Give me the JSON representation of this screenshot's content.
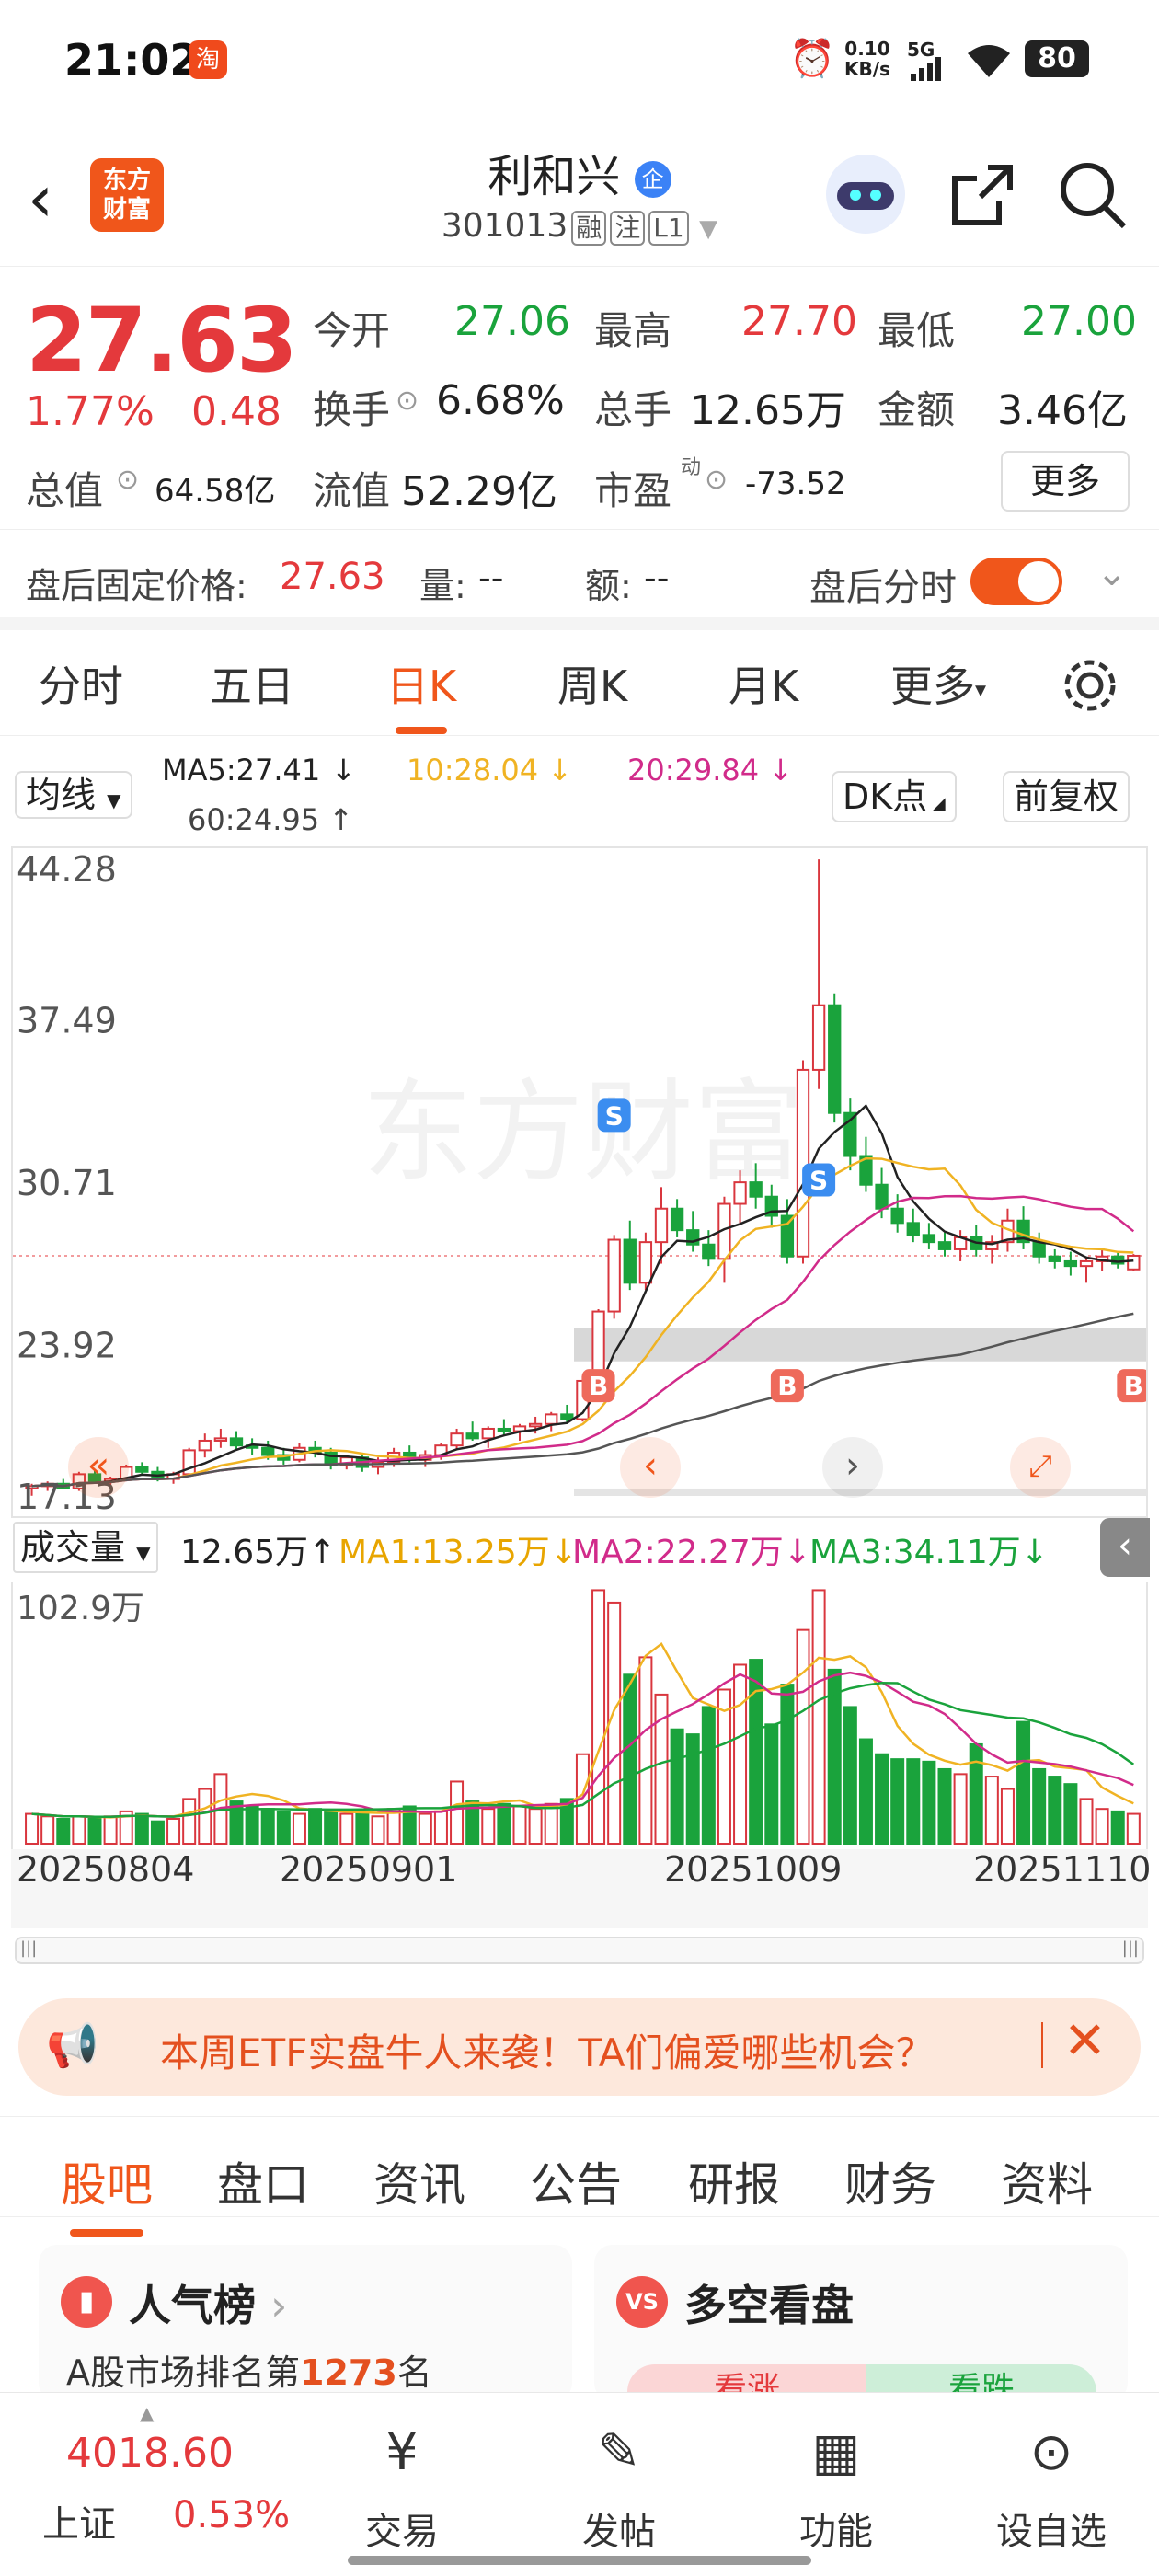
{
  "status": {
    "time": "21:02",
    "speed": "0.10\nKB/s",
    "speed_top": "0.10",
    "speed_bot": "KB/s",
    "network": "5G",
    "battery": "80"
  },
  "nav": {
    "logo_line1": "东方",
    "logo_line2": "财富",
    "name": "利和兴",
    "name_badge": "企",
    "code": "301013",
    "tags": [
      "融",
      "注",
      "L1"
    ]
  },
  "quote": {
    "price": "27.63",
    "change_pct": "1.77%",
    "change": "0.48",
    "open_label": "今开",
    "open": "27.06",
    "high_label": "最高",
    "high": "27.70",
    "low_label": "最低",
    "low": "27.00",
    "turnover_label": "换手",
    "turnover": "6.68%",
    "vol_label": "总手",
    "vol": "12.65万",
    "amount_label": "金额",
    "amount": "3.46亿",
    "mktcap_label": "总值",
    "mktcap": "64.58亿",
    "float_label": "流值",
    "float": "52.29亿",
    "pe_label": "市盈",
    "pe_sup": "动",
    "pe": "-73.52",
    "more_label": "更多"
  },
  "after_hours": {
    "price_label": "盘后固定价格:",
    "price": "27.63",
    "vol_label": "量:",
    "vol": "--",
    "amt_label": "额:",
    "amt": "--",
    "toggle_label": "盘后分时"
  },
  "tabs": [
    "分时",
    "五日",
    "日K",
    "周K",
    "月K",
    "更多"
  ],
  "active_tab": "日K",
  "indicators": {
    "ma_box": "均线",
    "ma5": "MA5:27.41",
    "ma10": "10:28.04",
    "ma20": "20:29.84",
    "ma60": "60:24.95",
    "dk_box": "DK点",
    "adj_box": "前复权"
  },
  "chart_data": {
    "type": "candlestick",
    "price_ticks": [
      "44.28",
      "37.49",
      "30.71",
      "23.92",
      "17.13"
    ],
    "ylim": [
      17.13,
      44.28
    ],
    "markers": [
      "S",
      "B",
      "S",
      "B",
      "B"
    ],
    "x_dates": [
      "20250804",
      "20250901",
      "20251009",
      "20251110"
    ],
    "colors": {
      "up": "#d9363e",
      "down": "#1aa33c",
      "ma5": "#222222",
      "ma10": "#f0b323",
      "ma20": "#d12b8a",
      "ma60": "#555555"
    },
    "candles": [
      [
        17.9,
        18.1,
        17.6,
        18.0
      ],
      [
        18.0,
        18.2,
        17.8,
        18.1
      ],
      [
        18.1,
        18.3,
        17.9,
        17.9
      ],
      [
        17.9,
        18.6,
        17.8,
        18.5
      ],
      [
        18.5,
        18.7,
        18.1,
        18.2
      ],
      [
        18.2,
        18.4,
        18.0,
        18.3
      ],
      [
        18.3,
        18.9,
        18.2,
        18.8
      ],
      [
        18.8,
        19.0,
        18.5,
        18.6
      ],
      [
        18.6,
        18.8,
        18.2,
        18.3
      ],
      [
        18.3,
        18.6,
        18.1,
        18.5
      ],
      [
        18.5,
        19.6,
        18.4,
        19.5
      ],
      [
        19.5,
        20.2,
        19.2,
        19.9
      ],
      [
        19.9,
        20.4,
        19.6,
        20.0
      ],
      [
        20.0,
        20.3,
        19.5,
        19.7
      ],
      [
        19.7,
        20.0,
        19.3,
        19.6
      ],
      [
        19.6,
        19.9,
        19.1,
        19.3
      ],
      [
        19.3,
        19.6,
        18.9,
        19.1
      ],
      [
        19.1,
        19.8,
        19.0,
        19.6
      ],
      [
        19.6,
        19.9,
        19.2,
        19.4
      ],
      [
        19.4,
        19.6,
        18.7,
        18.9
      ],
      [
        18.9,
        19.3,
        18.7,
        19.2
      ],
      [
        19.2,
        19.4,
        18.6,
        18.8
      ],
      [
        18.8,
        19.2,
        18.5,
        19.0
      ],
      [
        19.0,
        19.6,
        18.8,
        19.4
      ],
      [
        19.4,
        19.7,
        19.0,
        19.1
      ],
      [
        19.1,
        19.5,
        18.8,
        19.3
      ],
      [
        19.3,
        19.8,
        19.1,
        19.7
      ],
      [
        19.7,
        20.4,
        19.5,
        20.2
      ],
      [
        20.2,
        20.7,
        19.9,
        20.0
      ],
      [
        20.0,
        20.5,
        19.6,
        20.4
      ],
      [
        20.4,
        20.8,
        20.1,
        20.3
      ],
      [
        20.3,
        20.6,
        19.9,
        20.5
      ],
      [
        20.5,
        20.9,
        20.2,
        20.6
      ],
      [
        20.6,
        21.1,
        20.3,
        21.0
      ],
      [
        21.0,
        21.4,
        20.6,
        20.8
      ],
      [
        20.8,
        22.6,
        20.7,
        22.4
      ],
      [
        22.4,
        25.4,
        22.2,
        25.3
      ],
      [
        25.3,
        28.5,
        25.0,
        28.3
      ],
      [
        28.3,
        29.1,
        26.2,
        26.5
      ],
      [
        26.5,
        28.6,
        26.2,
        28.2
      ],
      [
        28.2,
        30.5,
        27.3,
        29.6
      ],
      [
        29.6,
        30.0,
        28.4,
        28.7
      ],
      [
        28.7,
        29.5,
        27.8,
        28.1
      ],
      [
        28.1,
        28.7,
        27.2,
        27.5
      ],
      [
        27.5,
        30.1,
        26.5,
        29.8
      ],
      [
        29.8,
        31.2,
        29.0,
        30.7
      ],
      [
        30.7,
        31.5,
        29.6,
        30.1
      ],
      [
        30.1,
        30.6,
        28.8,
        29.3
      ],
      [
        29.3,
        30.0,
        27.3,
        27.6
      ],
      [
        27.6,
        35.8,
        27.3,
        35.4
      ],
      [
        35.4,
        44.2,
        34.6,
        38.1
      ],
      [
        38.1,
        38.6,
        33.2,
        33.6
      ],
      [
        33.6,
        34.2,
        31.2,
        31.8
      ],
      [
        31.8,
        32.6,
        30.3,
        30.6
      ],
      [
        30.6,
        31.3,
        29.2,
        29.6
      ],
      [
        29.6,
        30.2,
        28.6,
        29.0
      ],
      [
        29.0,
        29.6,
        28.2,
        28.5
      ],
      [
        28.5,
        29.0,
        27.9,
        28.2
      ],
      [
        28.2,
        28.6,
        27.6,
        27.9
      ],
      [
        27.9,
        28.7,
        27.4,
        28.4
      ],
      [
        28.4,
        28.9,
        27.6,
        27.9
      ],
      [
        27.9,
        28.5,
        27.3,
        28.2
      ],
      [
        28.2,
        29.6,
        27.8,
        29.1
      ],
      [
        29.1,
        29.7,
        27.9,
        28.2
      ],
      [
        28.2,
        28.6,
        27.3,
        27.6
      ],
      [
        27.6,
        27.9,
        27.1,
        27.4
      ],
      [
        27.4,
        27.8,
        26.8,
        27.2
      ],
      [
        27.2,
        27.6,
        26.5,
        27.4
      ],
      [
        27.4,
        27.9,
        27.0,
        27.6
      ],
      [
        27.6,
        27.8,
        27.1,
        27.3
      ],
      [
        27.06,
        27.7,
        27.0,
        27.63
      ]
    ],
    "volume": {
      "label": "成交量",
      "value": "12.65万",
      "ma1": "MA1:13.25万",
      "ma2": "MA2:22.27万",
      "ma3": "MA3:34.11万",
      "max_tick": "102.9万",
      "ymax": 102.9,
      "values": [
        12,
        11,
        10,
        11,
        10,
        11,
        13,
        12,
        9,
        10,
        18,
        22,
        28,
        17,
        15,
        14,
        13,
        12,
        14,
        13,
        12,
        12,
        11,
        14,
        15,
        12,
        13,
        25,
        17,
        14,
        16,
        15,
        14,
        16,
        18,
        36,
        102,
        97,
        68,
        75,
        60,
        46,
        44,
        55,
        62,
        72,
        74,
        48,
        64,
        86,
        102,
        70,
        55,
        42,
        36,
        34,
        34,
        33,
        30,
        28,
        40,
        27,
        22,
        49,
        30,
        27,
        24,
        18,
        14,
        13,
        12
      ]
    }
  },
  "banner_text": "本周ETF实盘牛人来袭！TA们偏爱哪些机会？",
  "bottom_tabs": [
    "股吧",
    "盘口",
    "资讯",
    "公告",
    "研报",
    "财务",
    "资料"
  ],
  "cards": {
    "left_title": "人气榜",
    "left_sub_prefix": "A股市场排名第",
    "left_rank": "1273",
    "left_sub_suffix": "名",
    "right_title": "多空看盘",
    "right_up": "看涨",
    "right_down": "看跌"
  },
  "bottom_bar": {
    "index_value": "4018.60",
    "index_name": "上证",
    "index_pct": "0.53%",
    "items": [
      "交易",
      "发帖",
      "功能",
      "设自选"
    ]
  }
}
